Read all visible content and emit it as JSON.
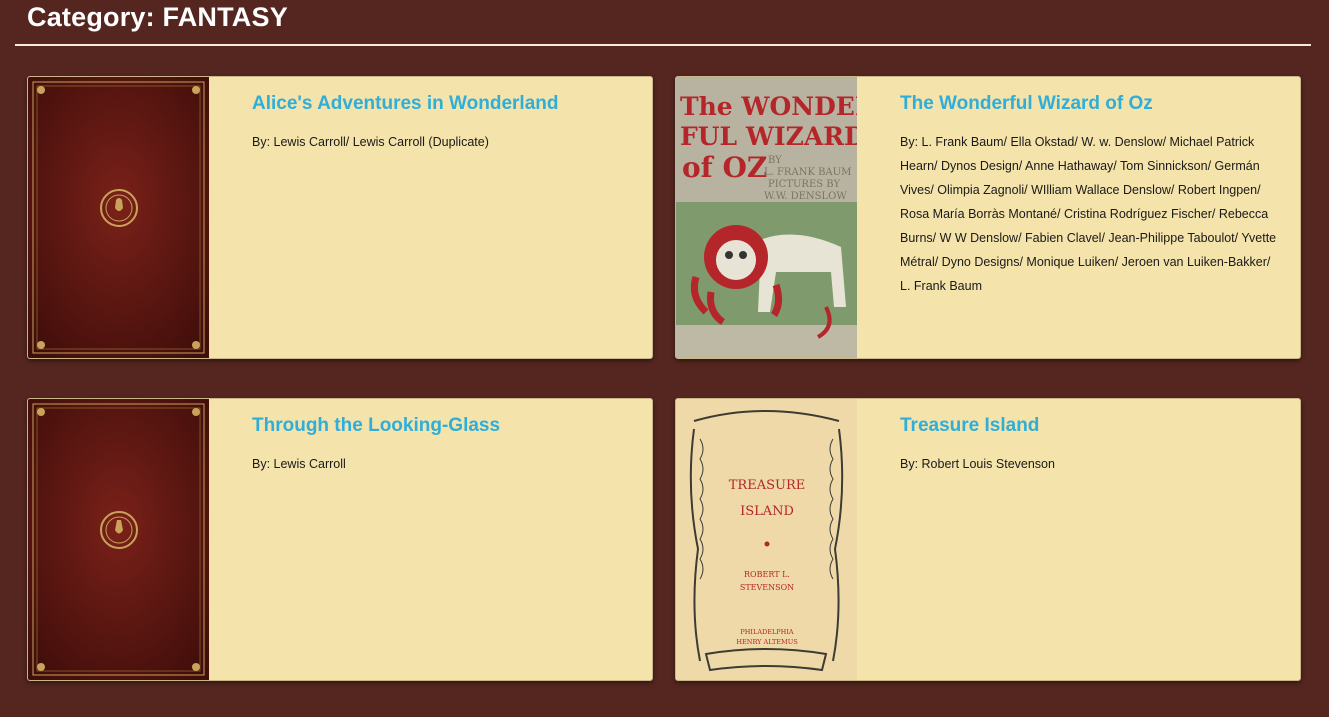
{
  "page": {
    "title": "Category: FANTASY"
  },
  "colors": {
    "background": "#55261f",
    "card": "#f4e3ab",
    "title_link": "#2eaed9",
    "leather": "#6a1a14",
    "gold": "#c9a35a"
  },
  "books": [
    {
      "title": "Alice's Adventures in Wonderland",
      "authors": "By: Lewis Carroll/ Lewis Carroll (Duplicate)",
      "cover_icon": "leather-book-cover-icon"
    },
    {
      "title": "The Wonderful Wizard of Oz",
      "authors": "By: L. Frank Baum/ Ella Okstad/ W. w. Denslow/ Michael Patrick Hearn/ Dynos Design/ Anne Hathaway/ Tom Sinnickson/ Germán Vives/ Olimpia Zagnoli/ WIlliam Wallace Denslow/ Robert Ingpen/ Rosa María Borràs Montané/ Cristina Rodríguez Fischer/ Rebecca Burns/ W W Denslow/ Fabien Clavel/ Jean-Philippe Taboulot/ Yvette Métral/ Dyno Designs/ Monique Luiken/ Jeroen van Luiken-Bakker/ L. Frank Baum",
      "cover_icon": "lion-illustration-cover-icon",
      "cover_text": {
        "line1": "The WONDER-",
        "line2": "FUL WIZARD",
        "line3": "of OZ",
        "by1": "BY",
        "by2": "L. FRANK BAUM",
        "by3": "PICTURES BY",
        "by4": "W.W. DENSLOW"
      }
    },
    {
      "title": "Through the Looking-Glass",
      "authors": "By: Lewis Carroll",
      "cover_icon": "leather-book-cover-icon"
    },
    {
      "title": "Treasure Island",
      "authors": "By: Robert Louis Stevenson",
      "cover_icon": "ornate-frame-cover-icon",
      "cover_text": {
        "line1": "TREASURE",
        "line2": "ISLAND",
        "author1": "ROBERT L.",
        "author2": "STEVENSON",
        "pub1": "PHILADELPHIA",
        "pub2": "HENRY ALTEMUS"
      }
    }
  ]
}
